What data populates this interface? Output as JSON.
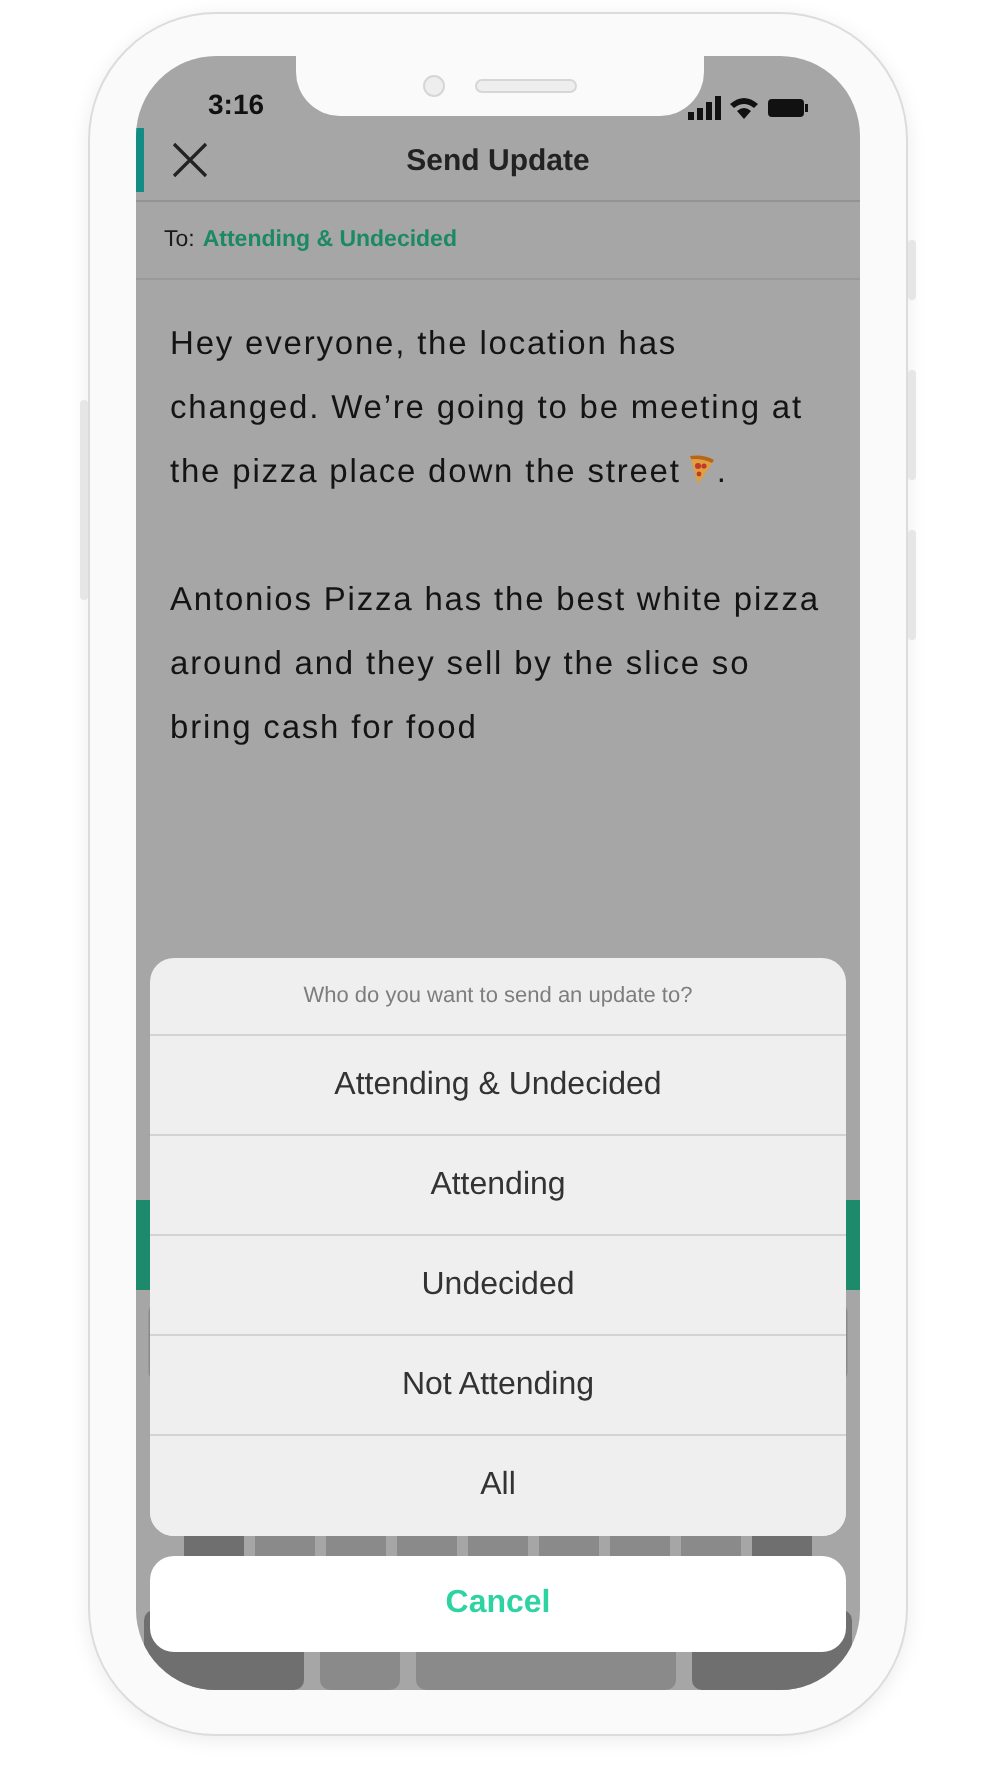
{
  "status_bar": {
    "time": "3:16"
  },
  "header": {
    "title": "Send Update"
  },
  "recipients": {
    "label": "To:",
    "value": "Attending & Undecided"
  },
  "message": {
    "paragraphs": [
      {
        "kind": "with_pizza",
        "text": "Hey everyone, the location has changed. We’re going to be meeting at the pizza place down the street",
        "after": "."
      },
      {
        "kind": "plain",
        "text": "Antonios Pizza has the best white pizza around and they sell by the slice so bring cash for food"
      }
    ]
  },
  "action_sheet": {
    "title": "Who do you want to send an update to?",
    "options": [
      "Attending & Undecided",
      "Attending",
      "Undecided",
      "Not Attending",
      "All"
    ],
    "cancel": "Cancel"
  }
}
